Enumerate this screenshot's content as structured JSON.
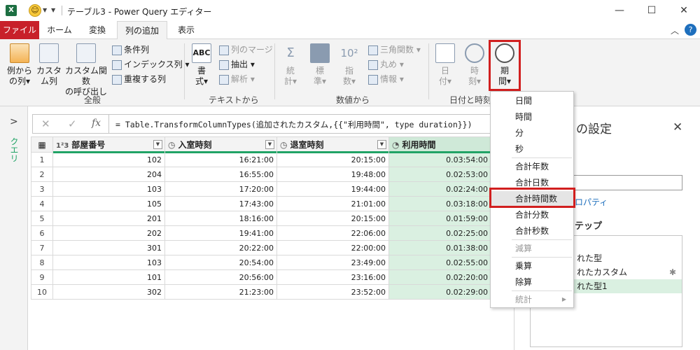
{
  "titlebar": {
    "title": "テーブル3 - Power Query エディター",
    "excel_glyph": "X"
  },
  "tabs": [
    "ファイル",
    "ホーム",
    "変換",
    "列の追加",
    "表示"
  ],
  "ribbon": {
    "general": {
      "example_col": "例から\nの列▾",
      "custom_col": "カスタ\nム列",
      "invoke_fn": "カスタム関数\nの呼び出し",
      "conditional": "条件列",
      "index": "インデックス列 ▾",
      "duplicate": "重複する列",
      "label": "全般"
    },
    "text": {
      "format": "書\n式▾",
      "merge": "列のマージ",
      "extract": "抽出 ▾",
      "parse": "解析 ▾",
      "label": "テキストから"
    },
    "number": {
      "stats": "統\n計▾",
      "standard": "標\n準▾",
      "scientific": "指\n数▾",
      "trig": "三角関数 ▾",
      "round": "丸め ▾",
      "info": "情報 ▾",
      "label": "数値から"
    },
    "datetime": {
      "date": "日\n付▾",
      "time": "時\n刻▾",
      "duration": "期\n間▾",
      "label": "日付と時刻"
    }
  },
  "formula": {
    "cancel": "✕",
    "commit": "✓",
    "fx": "fx",
    "text": "= Table.TransformColumnTypes(追加されたカスタム,{{\"利用時間\", type duration}})"
  },
  "leftpane": {
    "label": "クエリ",
    "chevron": ">"
  },
  "grid": {
    "headers": [
      "部屋番号",
      "入室時刻",
      "退室時刻",
      "利用時間"
    ],
    "type_icons": [
      "1²3",
      "clock-icon",
      "clock-icon",
      "stopwatch-icon"
    ],
    "rows": [
      {
        "n": "1",
        "room": "102",
        "in": "16:21:00",
        "out": "20:15:00",
        "use": "0.03:54:00"
      },
      {
        "n": "2",
        "room": "204",
        "in": "16:55:00",
        "out": "19:48:00",
        "use": "0.02:53:00"
      },
      {
        "n": "3",
        "room": "103",
        "in": "17:20:00",
        "out": "19:44:00",
        "use": "0.02:24:00"
      },
      {
        "n": "4",
        "room": "105",
        "in": "17:43:00",
        "out": "21:01:00",
        "use": "0.03:18:00"
      },
      {
        "n": "5",
        "room": "201",
        "in": "18:16:00",
        "out": "20:15:00",
        "use": "0.01:59:00"
      },
      {
        "n": "6",
        "room": "202",
        "in": "19:41:00",
        "out": "22:06:00",
        "use": "0.02:25:00"
      },
      {
        "n": "7",
        "room": "301",
        "in": "20:22:00",
        "out": "22:00:00",
        "use": "0.01:38:00"
      },
      {
        "n": "8",
        "room": "103",
        "in": "20:54:00",
        "out": "23:49:00",
        "use": "0.02:55:00"
      },
      {
        "n": "9",
        "room": "101",
        "in": "20:56:00",
        "out": "23:16:00",
        "use": "0.02:20:00"
      },
      {
        "n": "10",
        "room": "302",
        "in": "21:23:00",
        "out": "23:52:00",
        "use": "0.02:29:00"
      }
    ]
  },
  "rightpane": {
    "title": "の設定",
    "properties": "ロパティ",
    "steps_title": "テップ",
    "steps": [
      "れた型",
      "れたカスタム",
      "れた型1"
    ]
  },
  "menu": {
    "items": [
      "日間",
      "時間",
      "分",
      "秒",
      "合計年数",
      "合計日数",
      "合計時間数",
      "合計分数",
      "合計秒数",
      "減算",
      "乗算",
      "除算",
      "統計"
    ]
  },
  "colors": {
    "accent": "#21a366",
    "file_tab": "#c8202a",
    "highlight": "#d11f1f",
    "selected_col": "#daf0e1"
  }
}
